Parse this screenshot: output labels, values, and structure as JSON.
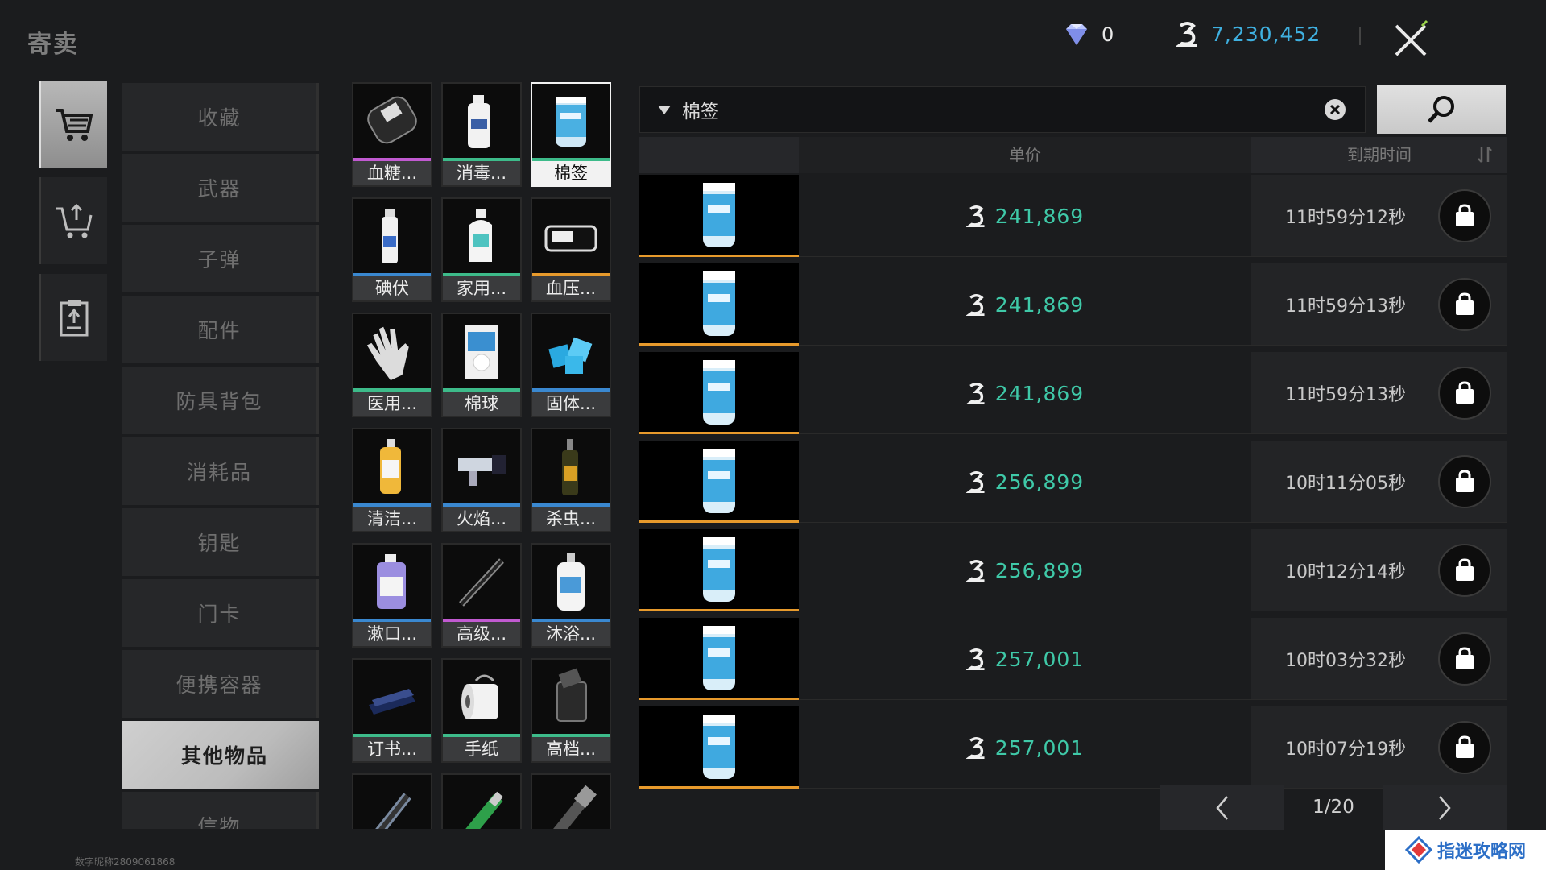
{
  "window": {
    "title": "寄卖"
  },
  "currency": {
    "gems": "0",
    "coins": "7,230,452",
    "coin_color": "#3fb0e0"
  },
  "left_nav": [
    {
      "icon": "shopping-cart-icon",
      "active": true
    },
    {
      "icon": "cart-upload-icon",
      "active": false
    },
    {
      "icon": "clipboard-icon",
      "active": false
    }
  ],
  "categories": [
    {
      "label": "收藏"
    },
    {
      "label": "武器"
    },
    {
      "label": "子弹"
    },
    {
      "label": "配件"
    },
    {
      "label": "防具背包"
    },
    {
      "label": "消耗品"
    },
    {
      "label": "钥匙"
    },
    {
      "label": "门卡"
    },
    {
      "label": "便携容器"
    },
    {
      "label": "其他物品",
      "active": true
    },
    {
      "label": "信物"
    }
  ],
  "items": [
    {
      "label": "血糖...",
      "rarity": "purple",
      "icon": "glucometer-icon"
    },
    {
      "label": "消毒...",
      "rarity": "green",
      "icon": "disinfectant-bottle-icon"
    },
    {
      "label": "棉签",
      "rarity": "green",
      "icon": "cotton-swab-jar-icon",
      "selected": true
    },
    {
      "label": "碘伏",
      "rarity": "blue",
      "icon": "spray-bottle-icon"
    },
    {
      "label": "家用...",
      "rarity": "green",
      "icon": "alcohol-bottle-icon"
    },
    {
      "label": "血压...",
      "rarity": "orange",
      "icon": "blood-pressure-monitor-icon"
    },
    {
      "label": "医用...",
      "rarity": "green",
      "icon": "medical-glove-icon"
    },
    {
      "label": "棉球",
      "rarity": "green",
      "icon": "cotton-ball-bag-icon"
    },
    {
      "label": "固体...",
      "rarity": "blue",
      "icon": "fuel-cubes-icon"
    },
    {
      "label": "清洁...",
      "rarity": "blue",
      "icon": "cleaner-bottle-icon"
    },
    {
      "label": "火焰...",
      "rarity": "blue",
      "icon": "torch-lighter-icon"
    },
    {
      "label": "杀虫...",
      "rarity": "blue",
      "icon": "insecticide-spray-icon"
    },
    {
      "label": "漱口...",
      "rarity": "blue",
      "icon": "mouthwash-bottle-icon"
    },
    {
      "label": "高级...",
      "rarity": "purple",
      "icon": "premium-pen-icon"
    },
    {
      "label": "沐浴...",
      "rarity": "blue",
      "icon": "shower-gel-icon"
    },
    {
      "label": "订书...",
      "rarity": "green",
      "icon": "stapler-icon"
    },
    {
      "label": "手纸",
      "rarity": "green",
      "icon": "toilet-paper-icon"
    },
    {
      "label": "高档...",
      "rarity": "green",
      "icon": "zippo-lighter-icon"
    },
    {
      "label": "",
      "rarity": "blue",
      "icon": "flashlight-icon"
    },
    {
      "label": "",
      "rarity": "green",
      "icon": "lighter-icon"
    },
    {
      "label": "",
      "rarity": "blue",
      "icon": "shaver-icon"
    }
  ],
  "search": {
    "value": "棉签",
    "button_icon": "search-icon"
  },
  "table": {
    "col_price": "单价",
    "col_expire": "到期时间",
    "rows": [
      {
        "price": "241,869",
        "time": "11时59分12秒"
      },
      {
        "price": "241,869",
        "time": "11时59分13秒"
      },
      {
        "price": "241,869",
        "time": "11时59分13秒"
      },
      {
        "price": "256,899",
        "time": "10时11分05秒"
      },
      {
        "price": "256,899",
        "time": "10时12分14秒"
      },
      {
        "price": "257,001",
        "time": "10时03分32秒"
      },
      {
        "price": "257,001",
        "time": "10时07分19秒"
      }
    ]
  },
  "pager": {
    "page": "1/20"
  },
  "footer": {
    "user_id": "数字昵称2809061868",
    "watermark": "指迷攻略网"
  }
}
